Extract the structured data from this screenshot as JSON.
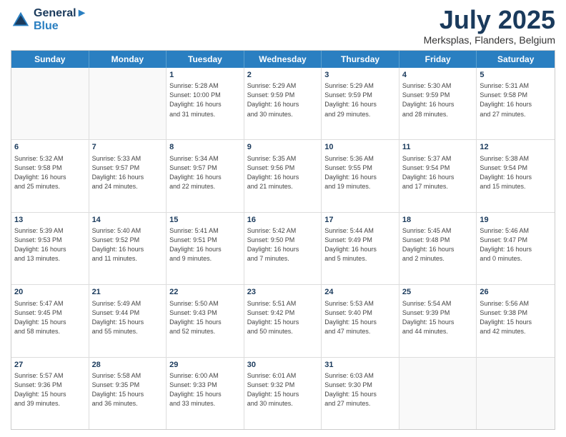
{
  "header": {
    "logo_line1": "General",
    "logo_line2": "Blue",
    "month": "July 2025",
    "location": "Merksplas, Flanders, Belgium"
  },
  "days_of_week": [
    "Sunday",
    "Monday",
    "Tuesday",
    "Wednesday",
    "Thursday",
    "Friday",
    "Saturday"
  ],
  "rows": [
    [
      {
        "day": "",
        "info": ""
      },
      {
        "day": "",
        "info": ""
      },
      {
        "day": "1",
        "info": "Sunrise: 5:28 AM\nSunset: 10:00 PM\nDaylight: 16 hours\nand 31 minutes."
      },
      {
        "day": "2",
        "info": "Sunrise: 5:29 AM\nSunset: 9:59 PM\nDaylight: 16 hours\nand 30 minutes."
      },
      {
        "day": "3",
        "info": "Sunrise: 5:29 AM\nSunset: 9:59 PM\nDaylight: 16 hours\nand 29 minutes."
      },
      {
        "day": "4",
        "info": "Sunrise: 5:30 AM\nSunset: 9:59 PM\nDaylight: 16 hours\nand 28 minutes."
      },
      {
        "day": "5",
        "info": "Sunrise: 5:31 AM\nSunset: 9:58 PM\nDaylight: 16 hours\nand 27 minutes."
      }
    ],
    [
      {
        "day": "6",
        "info": "Sunrise: 5:32 AM\nSunset: 9:58 PM\nDaylight: 16 hours\nand 25 minutes."
      },
      {
        "day": "7",
        "info": "Sunrise: 5:33 AM\nSunset: 9:57 PM\nDaylight: 16 hours\nand 24 minutes."
      },
      {
        "day": "8",
        "info": "Sunrise: 5:34 AM\nSunset: 9:57 PM\nDaylight: 16 hours\nand 22 minutes."
      },
      {
        "day": "9",
        "info": "Sunrise: 5:35 AM\nSunset: 9:56 PM\nDaylight: 16 hours\nand 21 minutes."
      },
      {
        "day": "10",
        "info": "Sunrise: 5:36 AM\nSunset: 9:55 PM\nDaylight: 16 hours\nand 19 minutes."
      },
      {
        "day": "11",
        "info": "Sunrise: 5:37 AM\nSunset: 9:54 PM\nDaylight: 16 hours\nand 17 minutes."
      },
      {
        "day": "12",
        "info": "Sunrise: 5:38 AM\nSunset: 9:54 PM\nDaylight: 16 hours\nand 15 minutes."
      }
    ],
    [
      {
        "day": "13",
        "info": "Sunrise: 5:39 AM\nSunset: 9:53 PM\nDaylight: 16 hours\nand 13 minutes."
      },
      {
        "day": "14",
        "info": "Sunrise: 5:40 AM\nSunset: 9:52 PM\nDaylight: 16 hours\nand 11 minutes."
      },
      {
        "day": "15",
        "info": "Sunrise: 5:41 AM\nSunset: 9:51 PM\nDaylight: 16 hours\nand 9 minutes."
      },
      {
        "day": "16",
        "info": "Sunrise: 5:42 AM\nSunset: 9:50 PM\nDaylight: 16 hours\nand 7 minutes."
      },
      {
        "day": "17",
        "info": "Sunrise: 5:44 AM\nSunset: 9:49 PM\nDaylight: 16 hours\nand 5 minutes."
      },
      {
        "day": "18",
        "info": "Sunrise: 5:45 AM\nSunset: 9:48 PM\nDaylight: 16 hours\nand 2 minutes."
      },
      {
        "day": "19",
        "info": "Sunrise: 5:46 AM\nSunset: 9:47 PM\nDaylight: 16 hours\nand 0 minutes."
      }
    ],
    [
      {
        "day": "20",
        "info": "Sunrise: 5:47 AM\nSunset: 9:45 PM\nDaylight: 15 hours\nand 58 minutes."
      },
      {
        "day": "21",
        "info": "Sunrise: 5:49 AM\nSunset: 9:44 PM\nDaylight: 15 hours\nand 55 minutes."
      },
      {
        "day": "22",
        "info": "Sunrise: 5:50 AM\nSunset: 9:43 PM\nDaylight: 15 hours\nand 52 minutes."
      },
      {
        "day": "23",
        "info": "Sunrise: 5:51 AM\nSunset: 9:42 PM\nDaylight: 15 hours\nand 50 minutes."
      },
      {
        "day": "24",
        "info": "Sunrise: 5:53 AM\nSunset: 9:40 PM\nDaylight: 15 hours\nand 47 minutes."
      },
      {
        "day": "25",
        "info": "Sunrise: 5:54 AM\nSunset: 9:39 PM\nDaylight: 15 hours\nand 44 minutes."
      },
      {
        "day": "26",
        "info": "Sunrise: 5:56 AM\nSunset: 9:38 PM\nDaylight: 15 hours\nand 42 minutes."
      }
    ],
    [
      {
        "day": "27",
        "info": "Sunrise: 5:57 AM\nSunset: 9:36 PM\nDaylight: 15 hours\nand 39 minutes."
      },
      {
        "day": "28",
        "info": "Sunrise: 5:58 AM\nSunset: 9:35 PM\nDaylight: 15 hours\nand 36 minutes."
      },
      {
        "day": "29",
        "info": "Sunrise: 6:00 AM\nSunset: 9:33 PM\nDaylight: 15 hours\nand 33 minutes."
      },
      {
        "day": "30",
        "info": "Sunrise: 6:01 AM\nSunset: 9:32 PM\nDaylight: 15 hours\nand 30 minutes."
      },
      {
        "day": "31",
        "info": "Sunrise: 6:03 AM\nSunset: 9:30 PM\nDaylight: 15 hours\nand 27 minutes."
      },
      {
        "day": "",
        "info": ""
      },
      {
        "day": "",
        "info": ""
      }
    ]
  ]
}
